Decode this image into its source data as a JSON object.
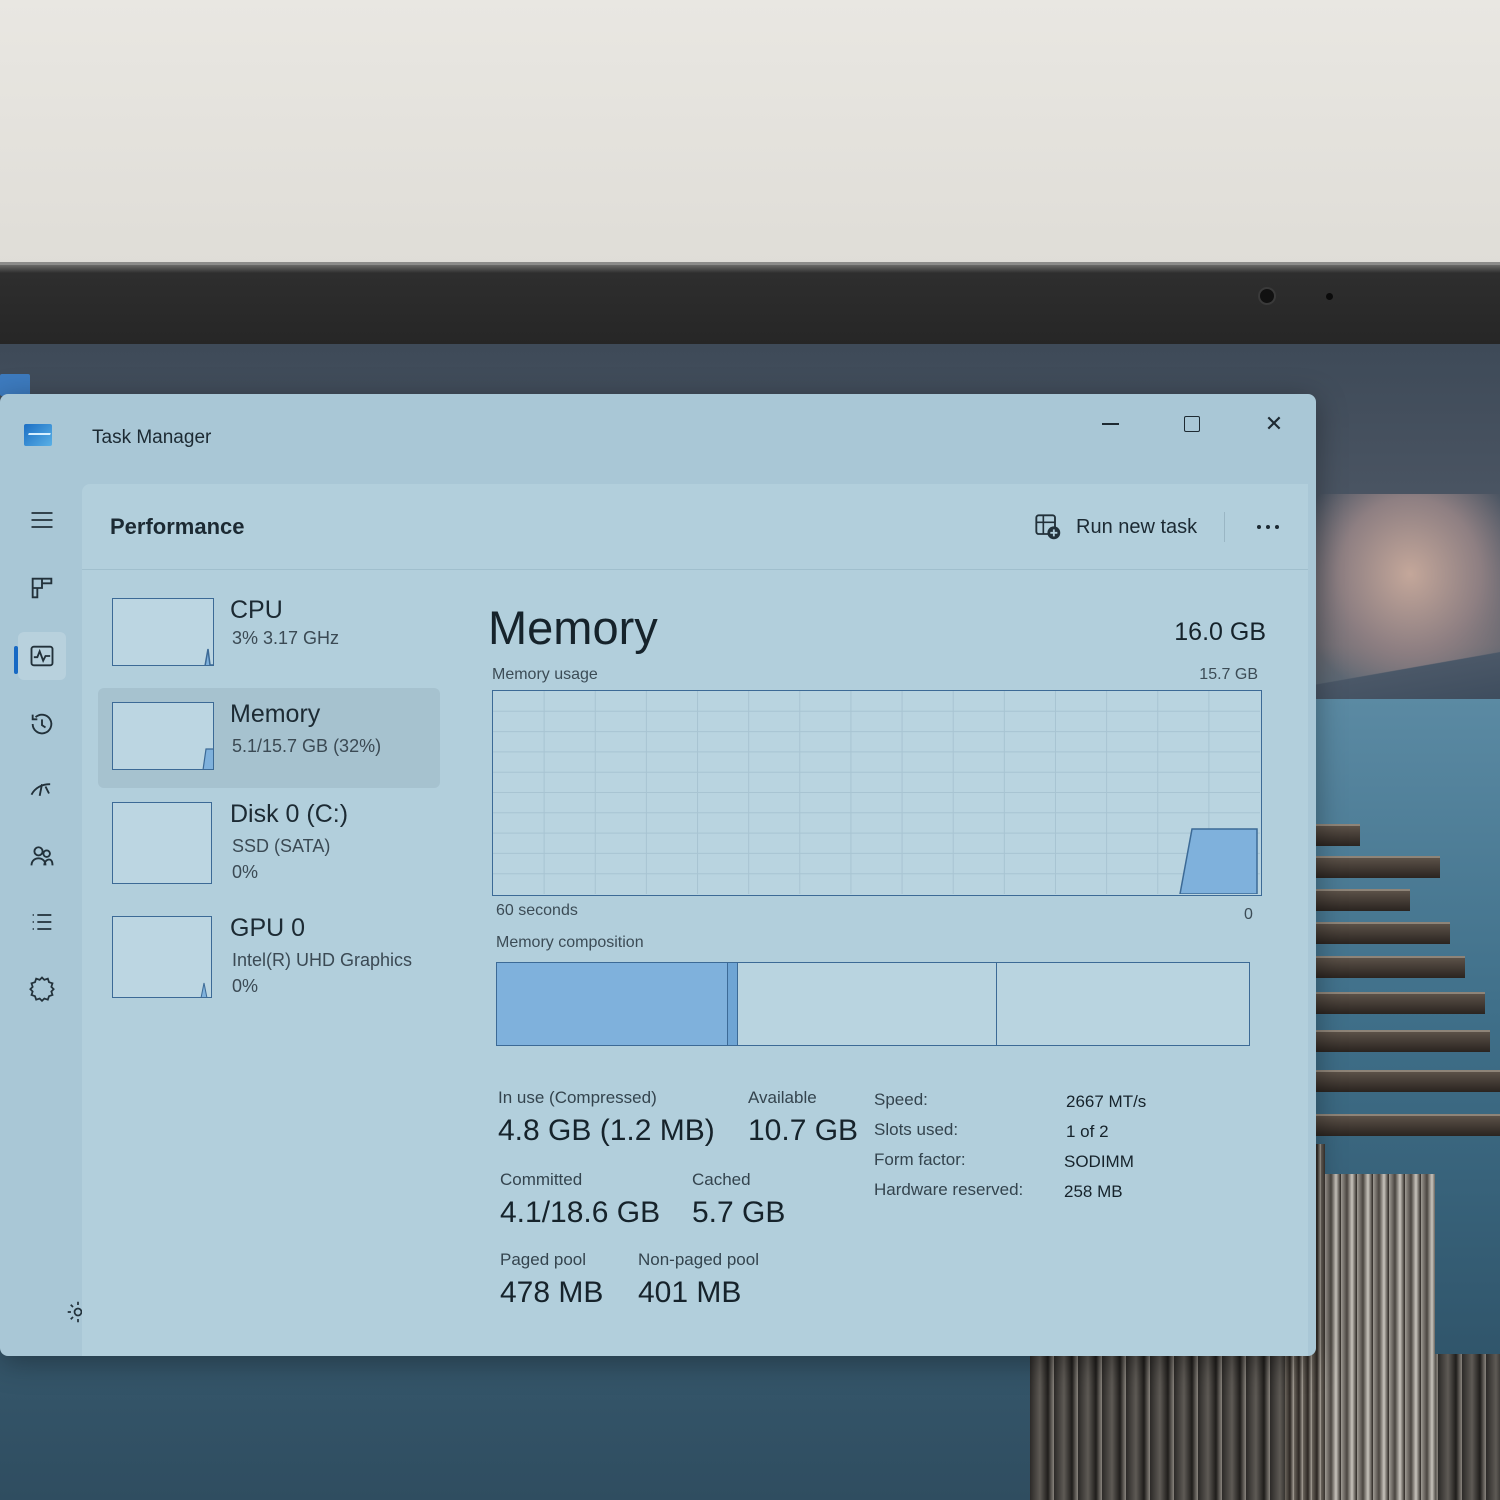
{
  "window": {
    "title": "Task Manager",
    "controls": {
      "minimize": "minimize",
      "maximize": "maximize",
      "close": "✕"
    }
  },
  "nav": {
    "items": [
      {
        "id": "menu",
        "icon": "hamburger-menu-icon"
      },
      {
        "id": "processes",
        "icon": "processes-icon"
      },
      {
        "id": "performance",
        "icon": "performance-icon",
        "selected": true
      },
      {
        "id": "app-history",
        "icon": "app-history-icon"
      },
      {
        "id": "startup",
        "icon": "startup-apps-icon"
      },
      {
        "id": "users",
        "icon": "users-icon"
      },
      {
        "id": "details",
        "icon": "details-icon"
      },
      {
        "id": "services",
        "icon": "services-icon"
      }
    ],
    "settings_icon": "settings-gear-icon"
  },
  "header": {
    "title": "Performance",
    "run_new_task": "Run new task",
    "more_icon": "more-options-icon"
  },
  "devices": [
    {
      "name": "CPU",
      "line1": "3%  3.17 GHz",
      "line2": "",
      "usage_pct": 3
    },
    {
      "name": "Memory",
      "line1": "5.1/15.7 GB (32%)",
      "line2": "",
      "usage_pct": 32,
      "selected": true
    },
    {
      "name": "Disk 0 (C:)",
      "line1": "SSD (SATA)",
      "line2": "0%",
      "usage_pct": 0
    },
    {
      "name": "GPU 0",
      "line1": "Intel(R) UHD Graphics",
      "line2": "0%",
      "usage_pct": 2
    }
  ],
  "detail": {
    "title": "Memory",
    "total": "16.0 GB",
    "usage_label": "Memory usage",
    "usage_max": "15.7 GB",
    "time_label": "60 seconds",
    "zero_label": "0",
    "composition_label": "Memory composition",
    "composition": {
      "in_use_gb": 4.8,
      "modified_gb": 0.2,
      "standby_gb": 5.4,
      "free_gb": 5.3,
      "total_gb": 15.7
    },
    "stats": {
      "in_use_label": "In use (Compressed)",
      "in_use_value": "4.8 GB (1.2 MB)",
      "available_label": "Available",
      "available_value": "10.7 GB",
      "committed_label": "Committed",
      "committed_value": "4.1/18.6 GB",
      "cached_label": "Cached",
      "cached_value": "5.7 GB",
      "paged_label": "Paged pool",
      "paged_value": "478 MB",
      "nonpaged_label": "Non-paged pool",
      "nonpaged_value": "401 MB"
    },
    "specs": {
      "speed_label": "Speed:",
      "speed_value": "2667 MT/s",
      "slots_label": "Slots used:",
      "slots_value": "1 of 2",
      "form_label": "Form factor:",
      "form_value": "SODIMM",
      "hw_label": "Hardware reserved:",
      "hw_value": "258 MB"
    }
  },
  "colors": {
    "accent": "#1769c4",
    "graph_fill": "#7fb1dc",
    "graph_border": "#3c6a96",
    "window_bg": "#a9c7d6"
  }
}
